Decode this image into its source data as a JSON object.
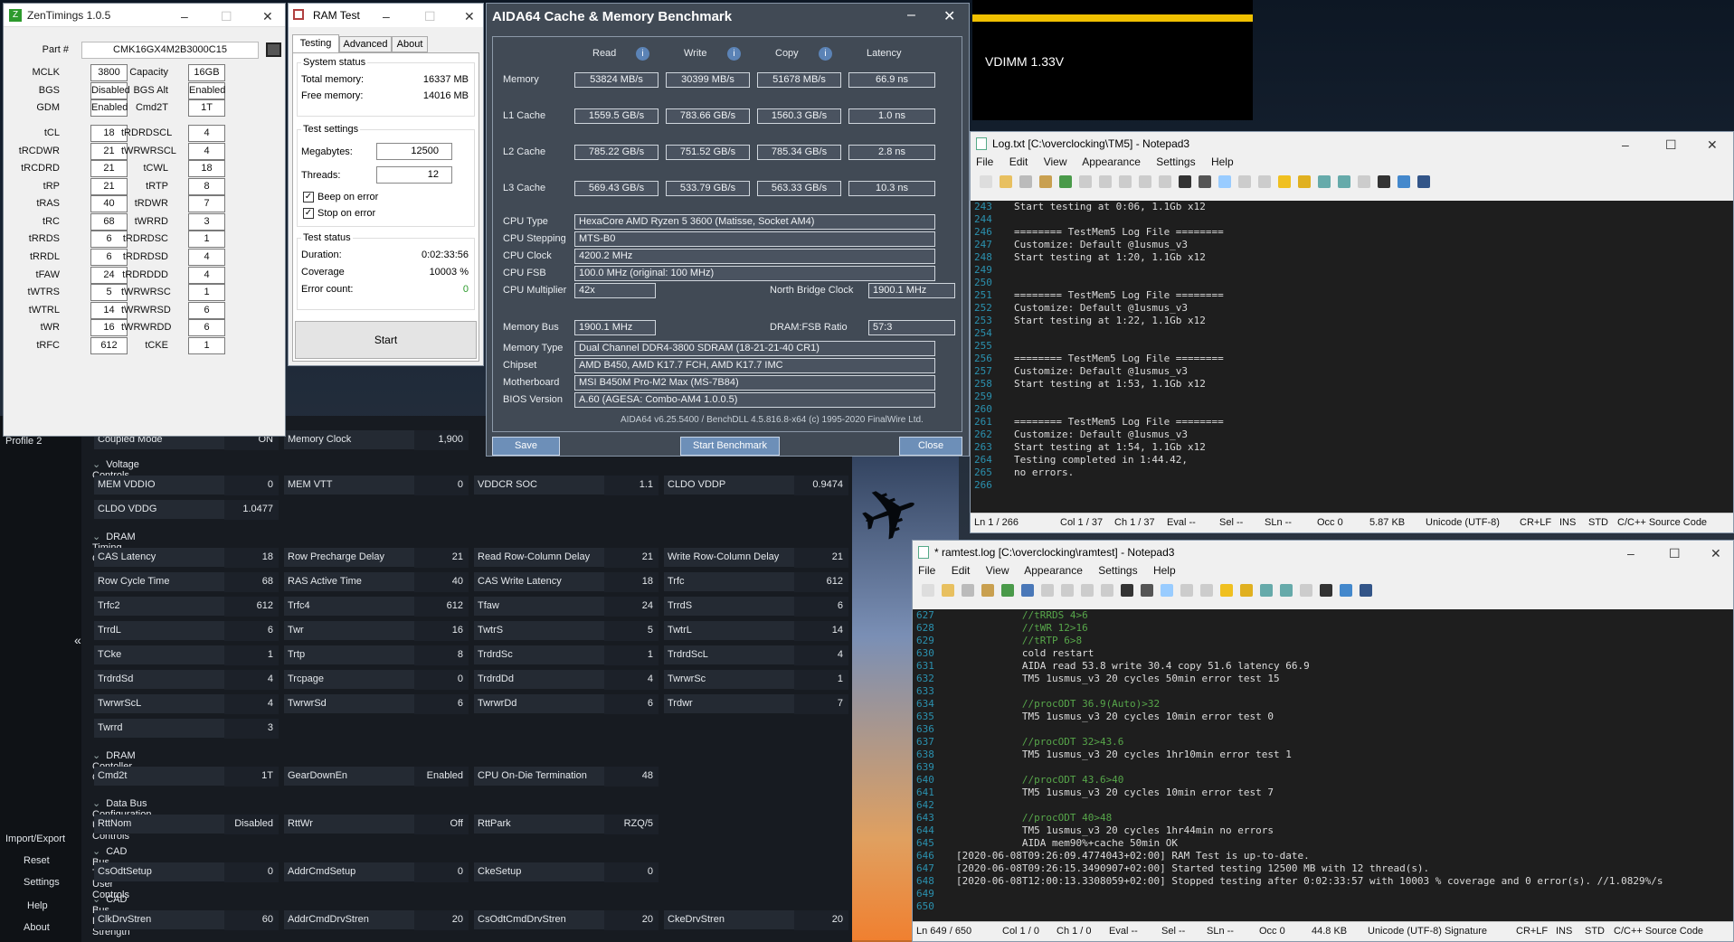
{
  "zentimings": {
    "title": "ZenTimings 1.0.5",
    "part_label": "Part #",
    "part_value": "CMK16GX4M2B3000C15",
    "left": [
      {
        "label": "MCLK",
        "value": "3800"
      },
      {
        "label": "BGS",
        "value": "Disabled"
      },
      {
        "label": "GDM",
        "value": "Enabled"
      },
      {
        "label": "tCL",
        "value": "18"
      },
      {
        "label": "tRCDWR",
        "value": "21"
      },
      {
        "label": "tRCDRD",
        "value": "21"
      },
      {
        "label": "tRP",
        "value": "21"
      },
      {
        "label": "tRAS",
        "value": "40"
      },
      {
        "label": "tRC",
        "value": "68"
      },
      {
        "label": "tRRDS",
        "value": "6"
      },
      {
        "label": "tRRDL",
        "value": "6"
      },
      {
        "label": "tFAW",
        "value": "24"
      },
      {
        "label": "tWTRS",
        "value": "5"
      },
      {
        "label": "tWTRL",
        "value": "14"
      },
      {
        "label": "tWR",
        "value": "16"
      },
      {
        "label": "tRFC",
        "value": "612"
      }
    ],
    "right": [
      {
        "label": "Capacity",
        "value": "16GB"
      },
      {
        "label": "BGS Alt",
        "value": "Enabled"
      },
      {
        "label": "Cmd2T",
        "value": "1T"
      },
      {
        "label": "tRDRDSCL",
        "value": "4"
      },
      {
        "label": "tWRWRSCL",
        "value": "4"
      },
      {
        "label": "tCWL",
        "value": "18"
      },
      {
        "label": "tRTP",
        "value": "8"
      },
      {
        "label": "tRDWR",
        "value": "7"
      },
      {
        "label": "tWRRD",
        "value": "3"
      },
      {
        "label": "tRDRDSC",
        "value": "1"
      },
      {
        "label": "tRDRDSD",
        "value": "4"
      },
      {
        "label": "tRDRDDD",
        "value": "4"
      },
      {
        "label": "tWRWRSC",
        "value": "1"
      },
      {
        "label": "tWRWRSD",
        "value": "6"
      },
      {
        "label": "tWRWRDD",
        "value": "6"
      },
      {
        "label": "tCKE",
        "value": "1"
      }
    ]
  },
  "ramtest": {
    "title": "RAM Test",
    "tabs": [
      "Testing",
      "Advanced",
      "About"
    ],
    "system_status": "System status",
    "total_memory_label": "Total memory:",
    "total_memory": "16337 MB",
    "free_memory_label": "Free memory:",
    "free_memory": "14016 MB",
    "test_settings": "Test settings",
    "megabytes_label": "Megabytes:",
    "megabytes": "12500",
    "threads_label": "Threads:",
    "threads": "12",
    "beep": "Beep on error",
    "stop": "Stop on error",
    "test_status": "Test status",
    "duration_label": "Duration:",
    "duration": "0:02:33:56",
    "coverage_label": "Coverage",
    "coverage": "10003 %",
    "error_label": "Error count:",
    "error": "0",
    "start": "Start"
  },
  "aida": {
    "title": "AIDA64 Cache & Memory Benchmark",
    "headers": [
      "Read",
      "Write",
      "Copy",
      "Latency"
    ],
    "rows": [
      {
        "label": "Memory",
        "values": [
          "53824 MB/s",
          "30399 MB/s",
          "51678 MB/s",
          "66.9 ns"
        ]
      },
      {
        "label": "L1 Cache",
        "values": [
          "1559.5 GB/s",
          "783.66 GB/s",
          "1560.3 GB/s",
          "1.0 ns"
        ]
      },
      {
        "label": "L2 Cache",
        "values": [
          "785.22 GB/s",
          "751.52 GB/s",
          "785.34 GB/s",
          "2.8 ns"
        ]
      },
      {
        "label": "L3 Cache",
        "values": [
          "569.43 GB/s",
          "533.79 GB/s",
          "563.33 GB/s",
          "10.3 ns"
        ]
      }
    ],
    "cpu_type_label": "CPU Type",
    "cpu_type": "HexaCore AMD Ryzen 5 3600  (Matisse, Socket AM4)",
    "cpu_stepping_label": "CPU Stepping",
    "cpu_stepping": "MTS-B0",
    "cpu_clock_label": "CPU Clock",
    "cpu_clock": "4200.2 MHz",
    "cpu_fsb_label": "CPU FSB",
    "cpu_fsb": "100.0 MHz  (original: 100 MHz)",
    "cpu_mult_label": "CPU Multiplier",
    "cpu_mult": "42x",
    "nb_clock_label": "North Bridge Clock",
    "nb_clock": "1900.1 MHz",
    "mem_bus_label": "Memory Bus",
    "mem_bus": "1900.1 MHz",
    "dram_fsb_label": "DRAM:FSB Ratio",
    "dram_fsb": "57:3",
    "mem_type_label": "Memory Type",
    "mem_type": "Dual Channel DDR4-3800 SDRAM  (18-21-21-40 CR1)",
    "chipset_label": "Chipset",
    "chipset": "AMD B450, AMD K17.7 FCH, AMD K17.7 IMC",
    "mobo_label": "Motherboard",
    "mobo": "MSI B450M Pro-M2 Max (MS-7B84)",
    "bios_label": "BIOS Version",
    "bios": "A.60  (AGESA: Combo-AM4 1.0.0.5)",
    "footer": "AIDA64 v6.25.5400 / BenchDLL 4.5.816.8-x64  (c) 1995-2020 FinalWire Ltd.",
    "save": "Save",
    "start": "Start Benchmark",
    "close": "Close"
  },
  "vdimm": {
    "text": "VDIMM 1.33V",
    "bar_color": "#f0c000"
  },
  "np1": {
    "title": "Log.txt [C:\\overclocking\\TM5] - Notepad3",
    "menu": [
      "File",
      "Edit",
      "View",
      "Appearance",
      "Settings",
      "Help"
    ],
    "lines": [
      {
        "n": "243",
        "t": "Start testing at 0:06, 1.1Gb x12"
      },
      {
        "n": "244",
        "t": ""
      },
      {
        "n": "246",
        "t": "======== TestMem5 Log File ========"
      },
      {
        "n": "247",
        "t": "Customize: Default @1usmus_v3"
      },
      {
        "n": "248",
        "t": "Start testing at 1:20, 1.1Gb x12"
      },
      {
        "n": "249",
        "t": ""
      },
      {
        "n": "250",
        "t": ""
      },
      {
        "n": "251",
        "t": "======== TestMem5 Log File ========"
      },
      {
        "n": "252",
        "t": "Customize: Default @1usmus_v3"
      },
      {
        "n": "253",
        "t": "Start testing at 1:22, 1.1Gb x12"
      },
      {
        "n": "254",
        "t": ""
      },
      {
        "n": "255",
        "t": ""
      },
      {
        "n": "256",
        "t": "======== TestMem5 Log File ========"
      },
      {
        "n": "257",
        "t": "Customize: Default @1usmus_v3"
      },
      {
        "n": "258",
        "t": "Start testing at 1:53, 1.1Gb x12"
      },
      {
        "n": "259",
        "t": ""
      },
      {
        "n": "260",
        "t": ""
      },
      {
        "n": "261",
        "t": "======== TestMem5 Log File ========"
      },
      {
        "n": "262",
        "t": "Customize: Default @1usmus_v3"
      },
      {
        "n": "263",
        "t": "Start testing at 1:54, 1.1Gb x12"
      },
      {
        "n": "264",
        "t": "Testing completed in 1:44.42,"
      },
      {
        "n": "265",
        "t": "no errors."
      },
      {
        "n": "266",
        "t": ""
      }
    ],
    "status": [
      "Ln 1 / 266",
      "Col 1 / 37",
      "Ch 1 / 37",
      "Eval --",
      "Sel --",
      "SLn --",
      "Occ 0",
      "5.87 KB",
      "Unicode (UTF-8)",
      "CR+LF",
      "INS",
      "STD",
      "C/C++ Source Code"
    ]
  },
  "np2": {
    "title": "* ramtest.log [C:\\overclocking\\ramtest] - Notepad3",
    "menu": [
      "File",
      "Edit",
      "View",
      "Appearance",
      "Settings",
      "Help"
    ],
    "lines": [
      {
        "n": "627",
        "t": "           //tRRDS 4>6",
        "c": "comment"
      },
      {
        "n": "628",
        "t": "           //tWR 12>16",
        "c": "comment"
      },
      {
        "n": "629",
        "t": "           //tRTP 6>8",
        "c": "comment"
      },
      {
        "n": "630",
        "t": "           cold restart",
        "c": ""
      },
      {
        "n": "631",
        "t": "           AIDA read 53.8 write 30.4 copy 51.6 latency 66.9",
        "c": ""
      },
      {
        "n": "632",
        "t": "           TM5 1usmus_v3 20 cycles 50min error test 15",
        "c": ""
      },
      {
        "n": "633",
        "t": "",
        "c": ""
      },
      {
        "n": "634",
        "t": "           //procODT 36.9(Auto)>32",
        "c": "comment"
      },
      {
        "n": "635",
        "t": "           TM5 1usmus_v3 20 cycles 10min error test 0",
        "c": ""
      },
      {
        "n": "636",
        "t": "",
        "c": ""
      },
      {
        "n": "637",
        "t": "           //procODT 32>43.6",
        "c": "comment"
      },
      {
        "n": "638",
        "t": "           TM5 1usmus_v3 20 cycles 1hr10min error test 1",
        "c": ""
      },
      {
        "n": "639",
        "t": "",
        "c": ""
      },
      {
        "n": "640",
        "t": "           //procODT 43.6>40",
        "c": "comment"
      },
      {
        "n": "641",
        "t": "           TM5 1usmus_v3 20 cycles 10min error test 7",
        "c": ""
      },
      {
        "n": "642",
        "t": "",
        "c": ""
      },
      {
        "n": "643",
        "t": "           //procODT 40>48",
        "c": "comment"
      },
      {
        "n": "644",
        "t": "           TM5 1usmus_v3 20 cycles 1hr44min no errors",
        "c": ""
      },
      {
        "n": "645",
        "t": "           AIDA mem90%+cache 50min OK",
        "c": ""
      },
      {
        "n": "646",
        "t": "[2020-06-08T09:26:09.4774043+02:00] RAM Test is up-to-date.",
        "c": ""
      },
      {
        "n": "647",
        "t": "[2020-06-08T09:26:15.3490907+02:00] Started testing 12500 MB with 12 thread(s).",
        "c": ""
      },
      {
        "n": "648",
        "t": "[2020-06-08T12:00:13.3308059+02:00] Stopped testing after 0:02:33:57 with 10003 % coverage and 0 error(s). //1.0829%/s",
        "c": ""
      },
      {
        "n": "649",
        "t": "",
        "c": ""
      },
      {
        "n": "650",
        "t": "",
        "c": ""
      }
    ],
    "status": [
      "Ln 649 / 650",
      "Col 1 / 0",
      "Ch 1 / 0",
      "Eval --",
      "Sel --",
      "SLn --",
      "Occ 0",
      "44.8 KB",
      "Unicode (UTF-8) Signature",
      "CR+LF",
      "INS",
      "STD",
      "C/C++ Source Code"
    ]
  },
  "ryzen": {
    "sidebar": [
      "Profile 2",
      "Import/Export",
      "Reset",
      "Settings",
      "Help",
      "About"
    ],
    "top_row": [
      {
        "label": "Coupled Mode",
        "value": "ON"
      },
      {
        "label": "Memory Clock",
        "value": "1,900"
      }
    ],
    "sections": [
      {
        "title": "Voltage Controls",
        "rows": [
          [
            {
              "label": "MEM VDDIO",
              "value": "0"
            },
            {
              "label": "MEM VTT",
              "value": "0"
            },
            {
              "label": "VDDCR SOC",
              "value": "1.1"
            },
            {
              "label": "CLDO VDDP",
              "value": "0.9474"
            }
          ],
          [
            {
              "label": "CLDO VDDG",
              "value": "1.0477"
            }
          ]
        ]
      },
      {
        "title": "DRAM Timing Configuration",
        "rows": [
          [
            {
              "label": "CAS Latency",
              "value": "18"
            },
            {
              "label": "Row Precharge Delay",
              "value": "21"
            },
            {
              "label": "Read Row-Column Delay",
              "value": "21"
            },
            {
              "label": "Write Row-Column Delay",
              "value": "21"
            }
          ],
          [
            {
              "label": "Row Cycle Time",
              "value": "68"
            },
            {
              "label": "RAS Active Time",
              "value": "40"
            },
            {
              "label": "CAS Write Latency",
              "value": "18"
            },
            {
              "label": "Trfc",
              "value": "612"
            }
          ],
          [
            {
              "label": "Trfc2",
              "value": "612"
            },
            {
              "label": "Trfc4",
              "value": "612"
            },
            {
              "label": "Tfaw",
              "value": "24"
            },
            {
              "label": "TrrdS",
              "value": "6"
            }
          ],
          [
            {
              "label": "TrrdL",
              "value": "6"
            },
            {
              "label": "Twr",
              "value": "16"
            },
            {
              "label": "TwtrS",
              "value": "5"
            },
            {
              "label": "TwtrL",
              "value": "14"
            }
          ],
          [
            {
              "label": "TCke",
              "value": "1"
            },
            {
              "label": "Trtp",
              "value": "8"
            },
            {
              "label": "TrdrdSc",
              "value": "1"
            },
            {
              "label": "TrdrdScL",
              "value": "4"
            }
          ],
          [
            {
              "label": "TrdrdSd",
              "value": "4"
            },
            {
              "label": "Trcpage",
              "value": "0"
            },
            {
              "label": "TrdrdDd",
              "value": "4"
            },
            {
              "label": "TwrwrSc",
              "value": "1"
            }
          ],
          [
            {
              "label": "TwrwrScL",
              "value": "4"
            },
            {
              "label": "TwrwrSd",
              "value": "6"
            },
            {
              "label": "TwrwrDd",
              "value": "6"
            },
            {
              "label": "Trdwr",
              "value": "7"
            }
          ],
          [
            {
              "label": "Twrrd",
              "value": "3"
            }
          ]
        ]
      },
      {
        "title": "DRAM Contoller Configuration",
        "rows": [
          [
            {
              "label": "Cmd2t",
              "value": "1T"
            },
            {
              "label": "GearDownEn",
              "value": "Enabled"
            },
            {
              "label": "CPU On-Die Termination",
              "value": "48"
            }
          ]
        ]
      },
      {
        "title": "Data Bus Configuration User Controls",
        "rows": [
          [
            {
              "label": "RttNom",
              "value": "Disabled"
            },
            {
              "label": "RttWr",
              "value": "Off"
            },
            {
              "label": "RttPark",
              "value": "RZQ/5"
            }
          ]
        ]
      },
      {
        "title": "CAD Bus Timing User Controls",
        "rows": [
          [
            {
              "label": "CsOdtSetup",
              "value": "0"
            },
            {
              "label": "AddrCmdSetup",
              "value": "0"
            },
            {
              "label": "CkeSetup",
              "value": "0"
            }
          ]
        ]
      },
      {
        "title": "CAD Bus Drive Strength",
        "rows": [
          [
            {
              "label": "ClkDrvStren",
              "value": "60"
            },
            {
              "label": "AddrCmdDrvStren",
              "value": "20"
            },
            {
              "label": "CsOdtCmdDrvStren",
              "value": "20"
            },
            {
              "label": "CkeDrvStren",
              "value": "20"
            }
          ]
        ]
      }
    ]
  }
}
